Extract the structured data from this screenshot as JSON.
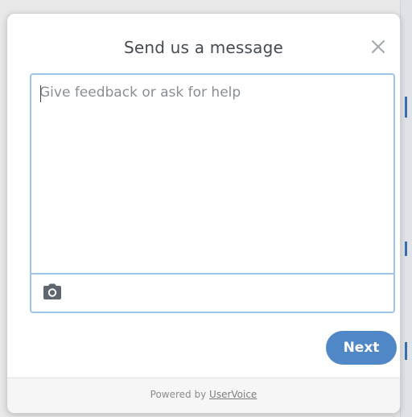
{
  "dialog": {
    "title": "Send us a message",
    "close_icon": "close-icon"
  },
  "composer": {
    "placeholder": "Give feedback or ask for help",
    "value": "",
    "attach_icon": "camera-icon"
  },
  "actions": {
    "next_label": "Next"
  },
  "footer": {
    "powered_by": "Powered by ",
    "brand": "UserVoice"
  },
  "colors": {
    "accent": "#4f87c7",
    "focus_border": "#9ec4ee",
    "title_text": "#444b53"
  }
}
